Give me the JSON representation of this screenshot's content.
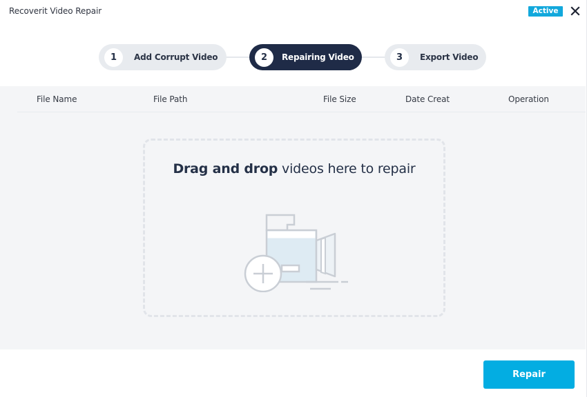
{
  "window": {
    "title": "Recoverit Video Repair",
    "status_badge": "Active",
    "close_icon": "close-icon"
  },
  "stepper": {
    "steps": [
      {
        "number": "1",
        "label": "Add Corrupt Video",
        "state": "inactive"
      },
      {
        "number": "2",
        "label": "Repairing Video",
        "state": "active"
      },
      {
        "number": "3",
        "label": "Export Video",
        "state": "inactive"
      }
    ]
  },
  "table": {
    "columns": [
      "File Name",
      "File Path",
      "File Size",
      "Date Creat",
      "Operation"
    ],
    "rows": []
  },
  "dropzone": {
    "bold_text": "Drag and drop",
    "rest_text": " videos here to repair",
    "icon": "video-camera-add-icon"
  },
  "footer": {
    "repair_label": "Repair"
  },
  "colors": {
    "accent": "#03ade2",
    "badge": "#12a8dc",
    "active_step": "#1f2b47",
    "inactive_step": "#e8ebef",
    "content_bg": "#f4f5f7"
  }
}
